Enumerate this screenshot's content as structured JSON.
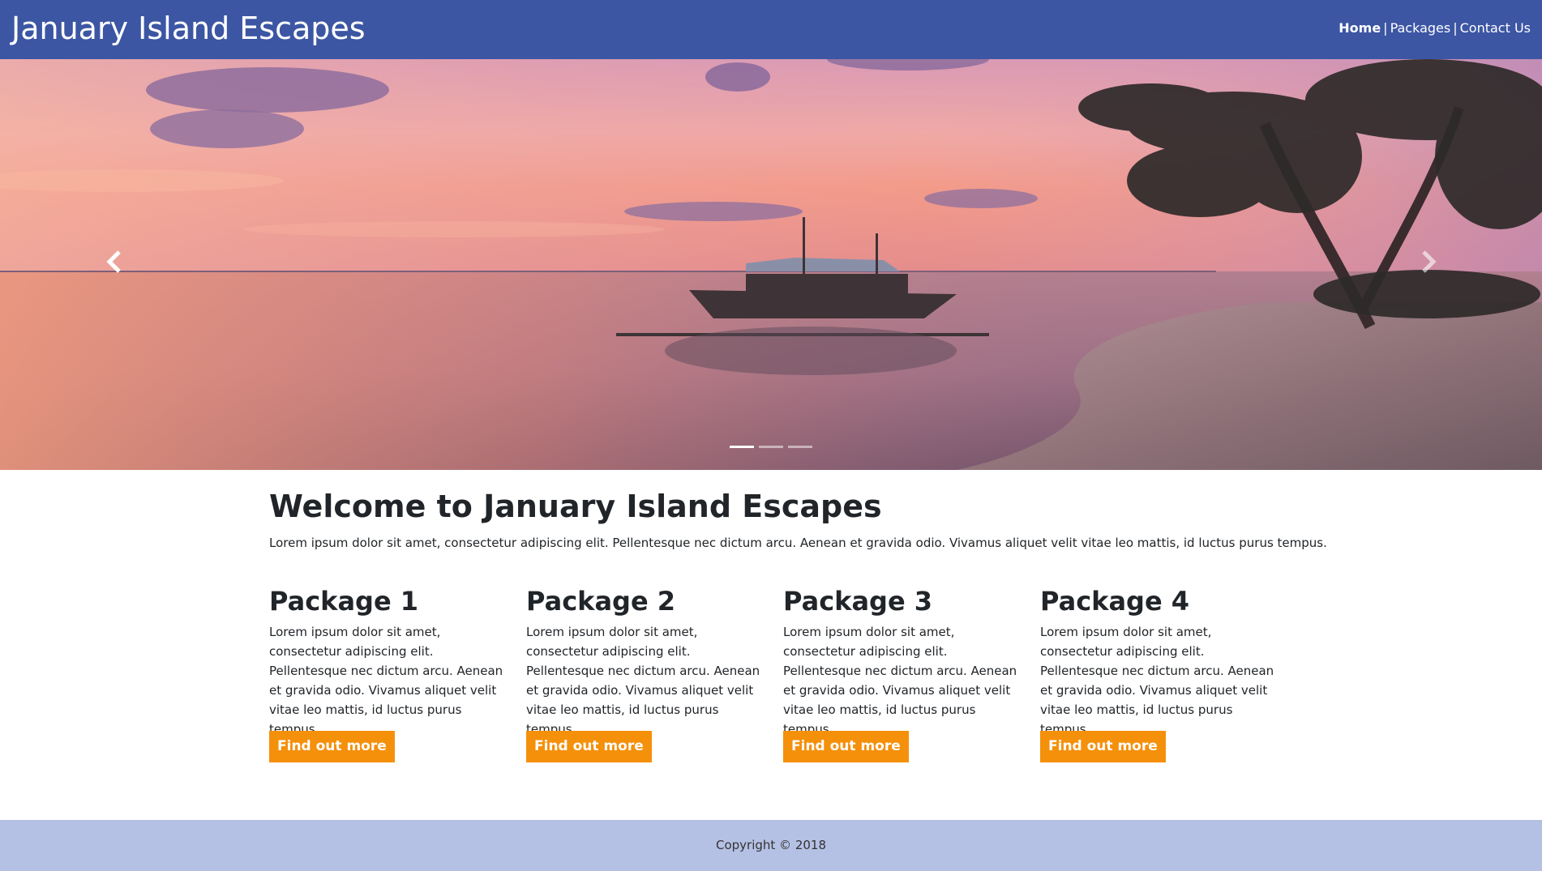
{
  "header": {
    "brand": "January Island Escapes",
    "nav": [
      {
        "label": "Home",
        "active": true
      },
      {
        "label": "Packages",
        "active": false
      },
      {
        "label": "Contact Us",
        "active": false
      }
    ],
    "separator": "|"
  },
  "carousel": {
    "prev_icon": "chevron-left-icon",
    "next_icon": "chevron-right-icon",
    "slide_count": 3,
    "active_slide": 1
  },
  "main": {
    "welcome_title": "Welcome to January Island Escapes",
    "welcome_text": "Lorem ipsum dolor sit amet, consectetur adipiscing elit. Pellentesque nec dictum arcu. Aenean et gravida odio. Vivamus aliquet velit vitae leo mattis, id luctus purus tempus.",
    "packages": [
      {
        "title": "Package 1",
        "text": "Lorem ipsum dolor sit amet, consectetur adipiscing elit. Pellentesque nec dictum arcu. Aenean et gravida odio. Vivamus aliquet velit vitae leo mattis, id luctus purus tempus.",
        "button": "Find out more"
      },
      {
        "title": "Package 2",
        "text": "Lorem ipsum dolor sit amet, consectetur adipiscing elit. Pellentesque nec dictum arcu. Aenean et gravida odio. Vivamus aliquet velit vitae leo mattis, id luctus purus tempus.",
        "button": "Find out more"
      },
      {
        "title": "Package 3",
        "text": "Lorem ipsum dolor sit amet, consectetur adipiscing elit. Pellentesque nec dictum arcu. Aenean et gravida odio. Vivamus aliquet velit vitae leo mattis, id luctus purus tempus.",
        "button": "Find out more"
      },
      {
        "title": "Package 4",
        "text": "Lorem ipsum dolor sit amet, consectetur adipiscing elit. Pellentesque nec dictum arcu. Aenean et gravida odio. Vivamus aliquet velit vitae leo mattis, id luctus purus tempus.",
        "button": "Find out more"
      }
    ]
  },
  "footer": {
    "copyright": "Copyright © 2018"
  },
  "colors": {
    "header_bg": "#3c56a4",
    "button_bg": "#f5900b",
    "footer_bg": "#b5c1e4"
  }
}
